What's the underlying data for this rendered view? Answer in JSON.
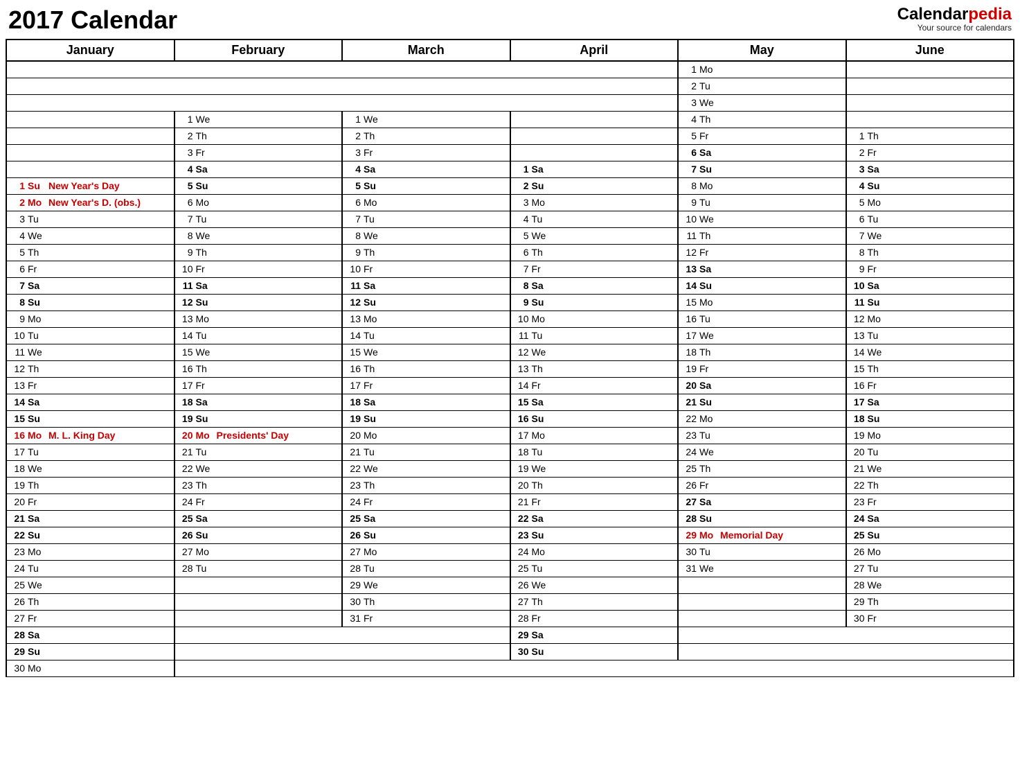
{
  "title": "2017 Calendar",
  "brand": {
    "part1": "Calendar",
    "part2": "pedia",
    "tagline": "Your source for calendars"
  },
  "months": [
    "January",
    "February",
    "March",
    "April",
    "May",
    "June"
  ],
  "rows": 37,
  "offsets": {
    "January": 7,
    "February": 3,
    "March": 3,
    "April": 6,
    "May": 0,
    "June": 4
  },
  "lengths": {
    "January": 31,
    "February": 28,
    "March": 31,
    "April": 30,
    "May": 31,
    "June": 30
  },
  "startDow": {
    "January": 0,
    "February": 3,
    "March": 3,
    "April": 6,
    "May": 1,
    "June": 4
  },
  "dowNames": [
    "Su",
    "Mo",
    "Tu",
    "We",
    "Th",
    "Fr",
    "Sa"
  ],
  "holidays": {
    "January": {
      "1": "New Year's Day",
      "2": "New Year's D. (obs.)",
      "16": "M. L. King Day"
    },
    "February": {
      "20": "Presidents' Day"
    },
    "May": {
      "29": "Memorial Day"
    }
  }
}
